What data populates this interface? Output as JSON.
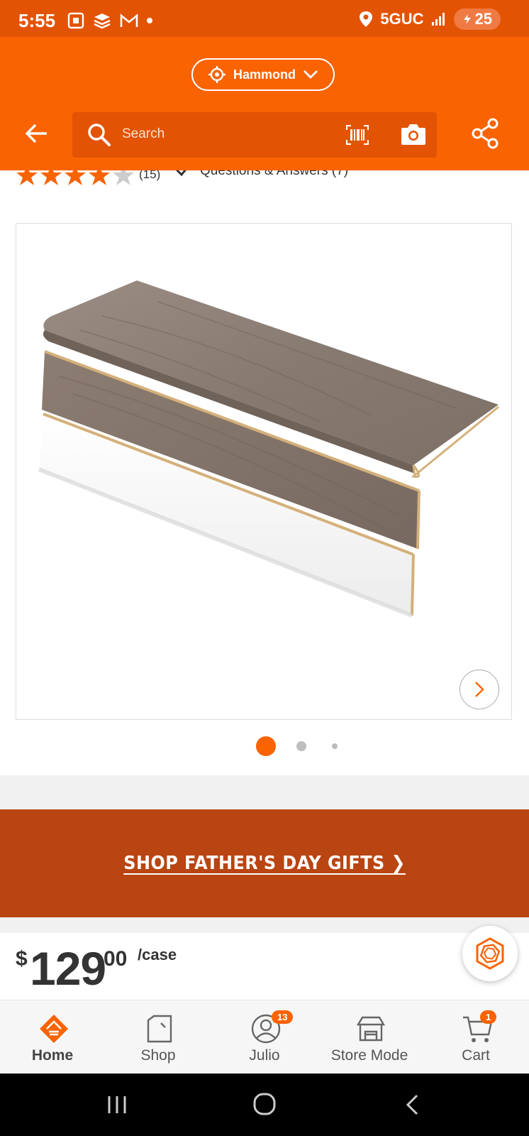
{
  "status_bar": {
    "time": "5:55",
    "network": "5GUC",
    "battery": "25"
  },
  "header": {
    "store_name": "Hammond",
    "search_placeholder": "Search"
  },
  "rating_strip": {
    "review_count": "(15)",
    "qa_label": "Questions & Answers (7)"
  },
  "carousel": {
    "total_slides": 3,
    "current_slide": 1
  },
  "promo": {
    "label": "SHOP FATHER'S DAY GIFTS ❯"
  },
  "price": {
    "currency": "$",
    "whole": "129",
    "cents": "00",
    "unit": "/case"
  },
  "bottom_nav": {
    "items": [
      {
        "label": "Home",
        "icon": "home-depot-logo-icon",
        "active": true
      },
      {
        "label": "Shop",
        "icon": "shop-icon"
      },
      {
        "label": "Julio",
        "icon": "account-icon",
        "badge": "13"
      },
      {
        "label": "Store Mode",
        "icon": "store-icon"
      },
      {
        "label": "Cart",
        "icon": "cart-icon",
        "badge": "1"
      }
    ]
  },
  "colors": {
    "brand_orange": "#f96302",
    "status_orange": "#e35304",
    "promo": "#b94512"
  }
}
